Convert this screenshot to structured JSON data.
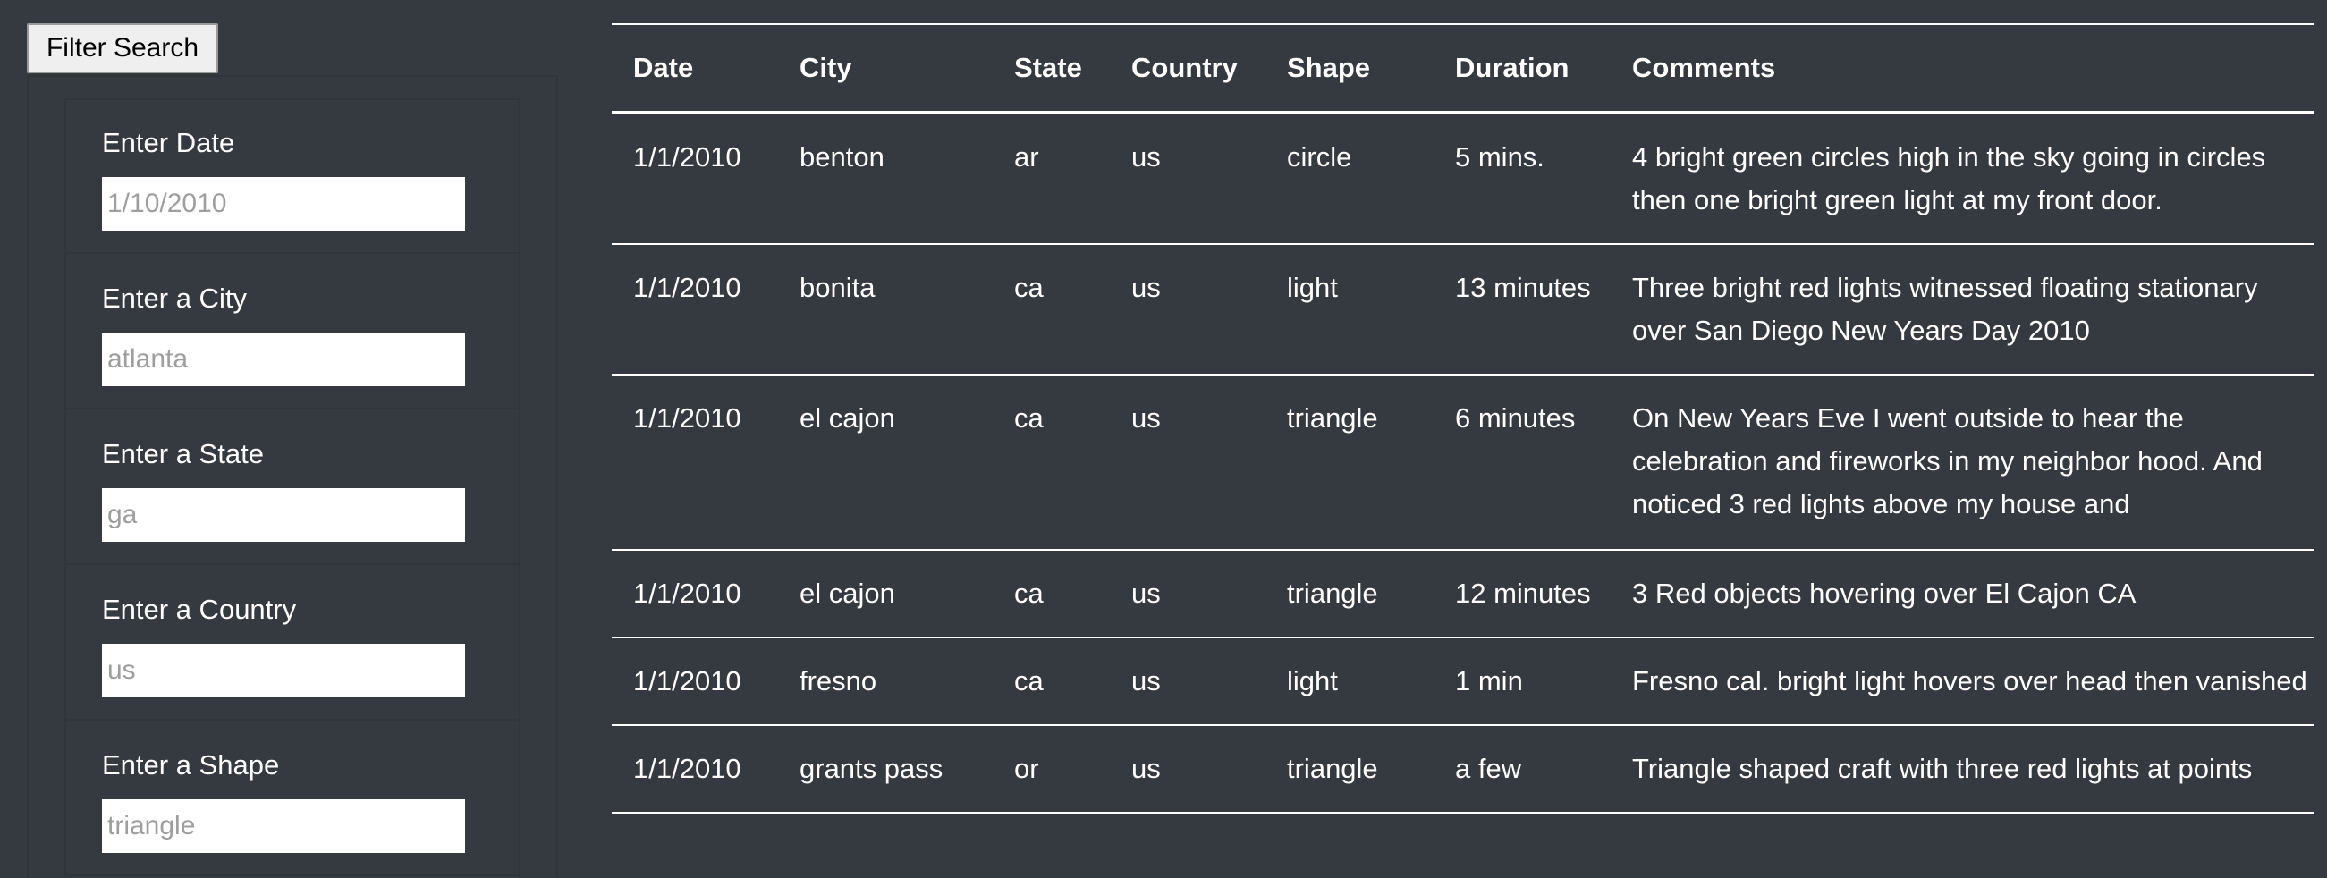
{
  "filter": {
    "button_label": "Filter Search",
    "fields": [
      {
        "label": "Enter Date",
        "placeholder": "1/10/2010"
      },
      {
        "label": "Enter a City",
        "placeholder": "atlanta"
      },
      {
        "label": "Enter a State",
        "placeholder": "ga"
      },
      {
        "label": "Enter a Country",
        "placeholder": "us"
      },
      {
        "label": "Enter a Shape",
        "placeholder": "triangle"
      }
    ]
  },
  "table": {
    "columns": [
      "Date",
      "City",
      "State",
      "Country",
      "Shape",
      "Duration",
      "Comments"
    ],
    "rows": [
      {
        "date": "1/1/2010",
        "city": "benton",
        "state": "ar",
        "country": "us",
        "shape": "circle",
        "duration": "5 mins.",
        "comments": "4 bright green circles high in the sky going in circles then one bright green light at my front door."
      },
      {
        "date": "1/1/2010",
        "city": "bonita",
        "state": "ca",
        "country": "us",
        "shape": "light",
        "duration": "13 minutes",
        "comments": "Three bright red lights witnessed floating stationary over San Diego New Years Day 2010"
      },
      {
        "date": "1/1/2010",
        "city": "el cajon",
        "state": "ca",
        "country": "us",
        "shape": "triangle",
        "duration": "6 minutes",
        "comments": "On New Years Eve I went outside to hear the celebration and fireworks in my neighbor hood. And noticed 3 red lights above my house and"
      },
      {
        "date": "1/1/2010",
        "city": "el cajon",
        "state": "ca",
        "country": "us",
        "shape": "triangle",
        "duration": "12 minutes",
        "comments": "3 Red objects hovering over El Cajon CA"
      },
      {
        "date": "1/1/2010",
        "city": "fresno",
        "state": "ca",
        "country": "us",
        "shape": "light",
        "duration": "1 min",
        "comments": "Fresno cal. bright light hovers over head then vanished"
      },
      {
        "date": "1/1/2010",
        "city": "grants pass",
        "state": "or",
        "country": "us",
        "shape": "triangle",
        "duration": "a few",
        "comments": "Triangle shaped craft with three red lights at points"
      }
    ]
  }
}
